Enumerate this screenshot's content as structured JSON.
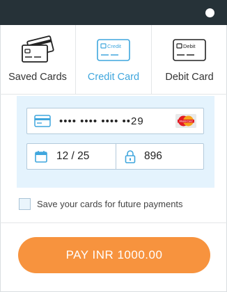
{
  "tabs": [
    {
      "label": "Saved Cards",
      "icon": "saved-cards-icon",
      "active": false
    },
    {
      "label": "Credit Card",
      "icon": "credit-card-icon",
      "active": true,
      "icon_text": "Credit"
    },
    {
      "label": "Debit Card",
      "icon": "debit-card-icon",
      "active": false,
      "icon_text": "Debit"
    }
  ],
  "card_form": {
    "card_number": "•••• •••• •••• ••29",
    "card_brand_text": "MasterCard",
    "expiry": "12 / 25",
    "cvv": "896"
  },
  "save_cards": {
    "label": "Save your cards for future payments",
    "checked": false
  },
  "pay_button": {
    "label": "PAY INR 1000.00"
  },
  "colors": {
    "topbar": "#263238",
    "accent_blue": "#3fa6dd",
    "pay_orange": "#f7933e",
    "panel_bg": "#e4f3fd"
  }
}
